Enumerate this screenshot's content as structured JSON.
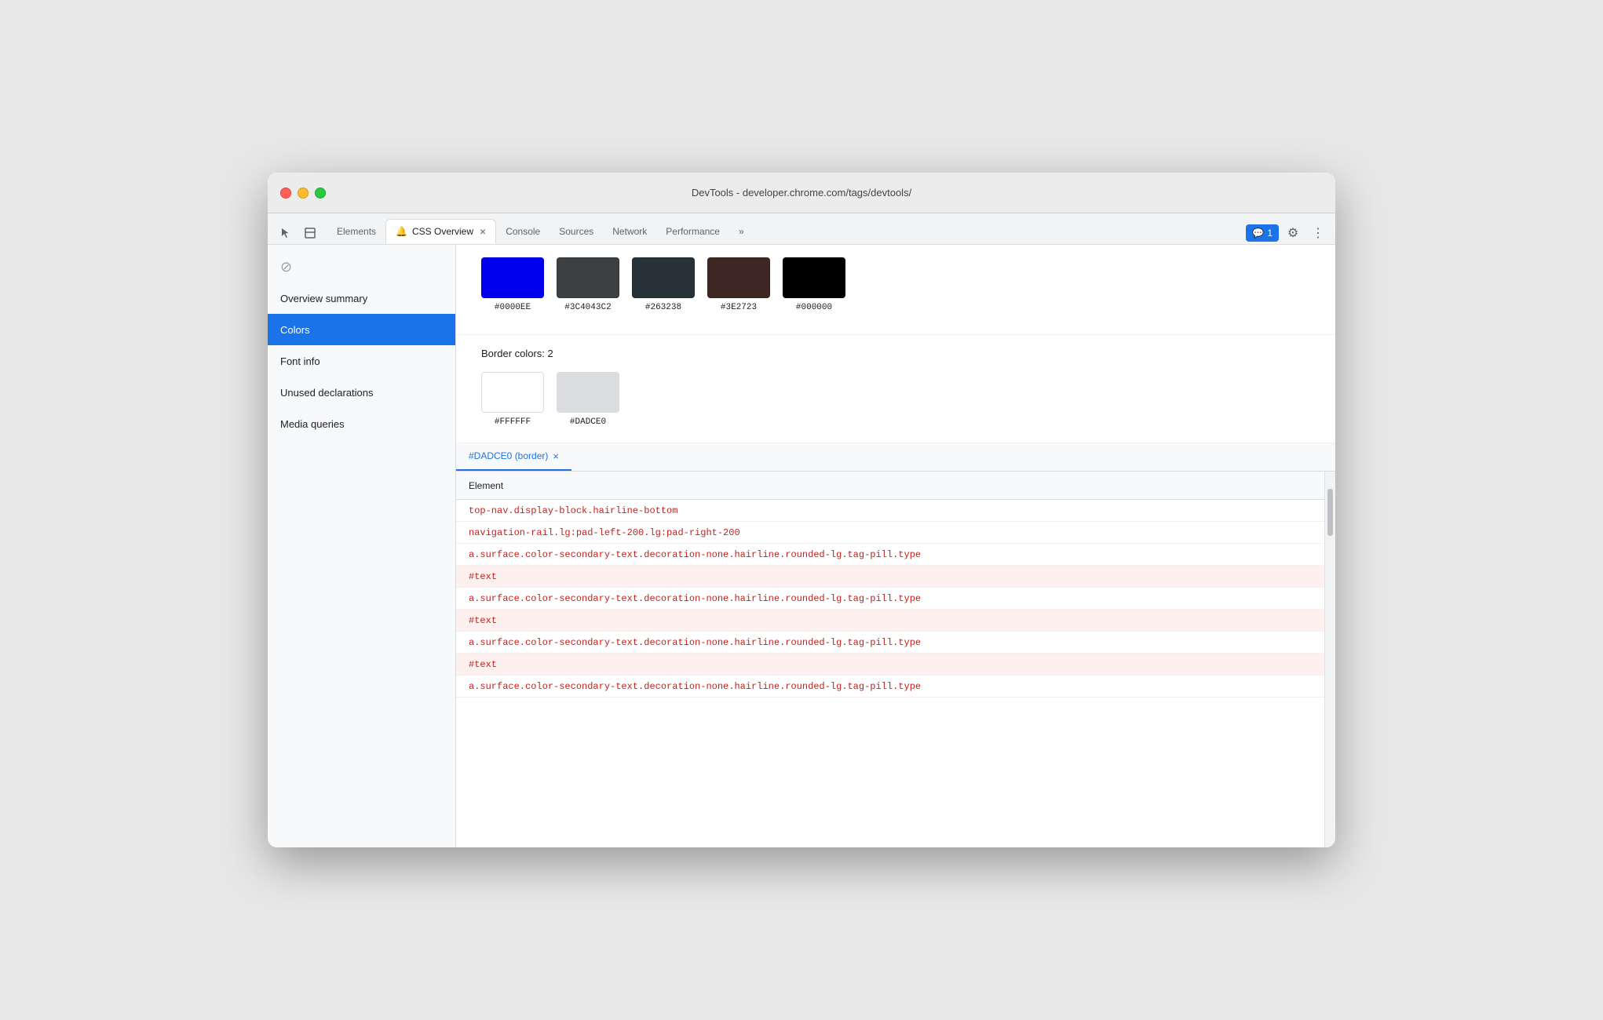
{
  "window": {
    "title": "DevTools - developer.chrome.com/tags/devtools/"
  },
  "tabs": [
    {
      "id": "elements",
      "label": "Elements",
      "active": false
    },
    {
      "id": "css-overview",
      "label": "CSS Overview",
      "active": true,
      "hasIcon": true,
      "closable": true
    },
    {
      "id": "console",
      "label": "Console",
      "active": false
    },
    {
      "id": "sources",
      "label": "Sources",
      "active": false
    },
    {
      "id": "network",
      "label": "Network",
      "active": false
    },
    {
      "id": "performance",
      "label": "Performance",
      "active": false
    }
  ],
  "tab_more_label": "»",
  "badge_count": "1",
  "sidebar": {
    "items": [
      {
        "id": "overview-summary",
        "label": "Overview summary",
        "active": false
      },
      {
        "id": "colors",
        "label": "Colors",
        "active": true
      },
      {
        "id": "font-info",
        "label": "Font info",
        "active": false
      },
      {
        "id": "unused-declarations",
        "label": "Unused declarations",
        "active": false
      },
      {
        "id": "media-queries",
        "label": "Media queries",
        "active": false
      }
    ]
  },
  "colors_section": {
    "top_swatches": [
      {
        "hex": "#0000EE",
        "color": "#0000EE"
      },
      {
        "hex": "#3C4043C2",
        "color": "#3C4043"
      },
      {
        "hex": "#263238",
        "color": "#263238"
      },
      {
        "hex": "#3E2723",
        "color": "#3E2723"
      },
      {
        "hex": "#000000",
        "color": "#000000"
      }
    ],
    "border_colors_title": "Border colors: 2",
    "border_swatches": [
      {
        "hex": "#FFFFFF",
        "color": "#FFFFFF"
      },
      {
        "hex": "#DADCE0",
        "color": "#DADCE0"
      }
    ]
  },
  "panel": {
    "tab_label": "#DADCE0 (border)",
    "tab_id": "dadce0-border",
    "table_header": "Element",
    "rows": [
      {
        "text": "top-nav.display-block.hairline-bottom",
        "type": "element"
      },
      {
        "text": "navigation-rail.lg:pad-left-200.lg:pad-right-200",
        "type": "element"
      },
      {
        "text": "a.surface.color-secondary-text.decoration-none.hairline.rounded-lg.tag-pill.type",
        "type": "element"
      },
      {
        "text": "#text",
        "type": "text-node"
      },
      {
        "text": "a.surface.color-secondary-text.decoration-none.hairline.rounded-lg.tag-pill.type",
        "type": "element"
      },
      {
        "text": "#text",
        "type": "text-node"
      },
      {
        "text": "a.surface.color-secondary-text.decoration-none.hairline.rounded-lg.tag-pill.type",
        "type": "element"
      },
      {
        "text": "#text",
        "type": "text-node"
      },
      {
        "text": "a.surface.color-secondary-text.decoration-none.hairline.rounded-lg.tag-pill.type",
        "type": "element"
      }
    ]
  },
  "icons": {
    "cursor": "⊘",
    "dock": "⧉",
    "close": "×",
    "gear": "⚙",
    "more": "⋮",
    "chat": "💬"
  }
}
